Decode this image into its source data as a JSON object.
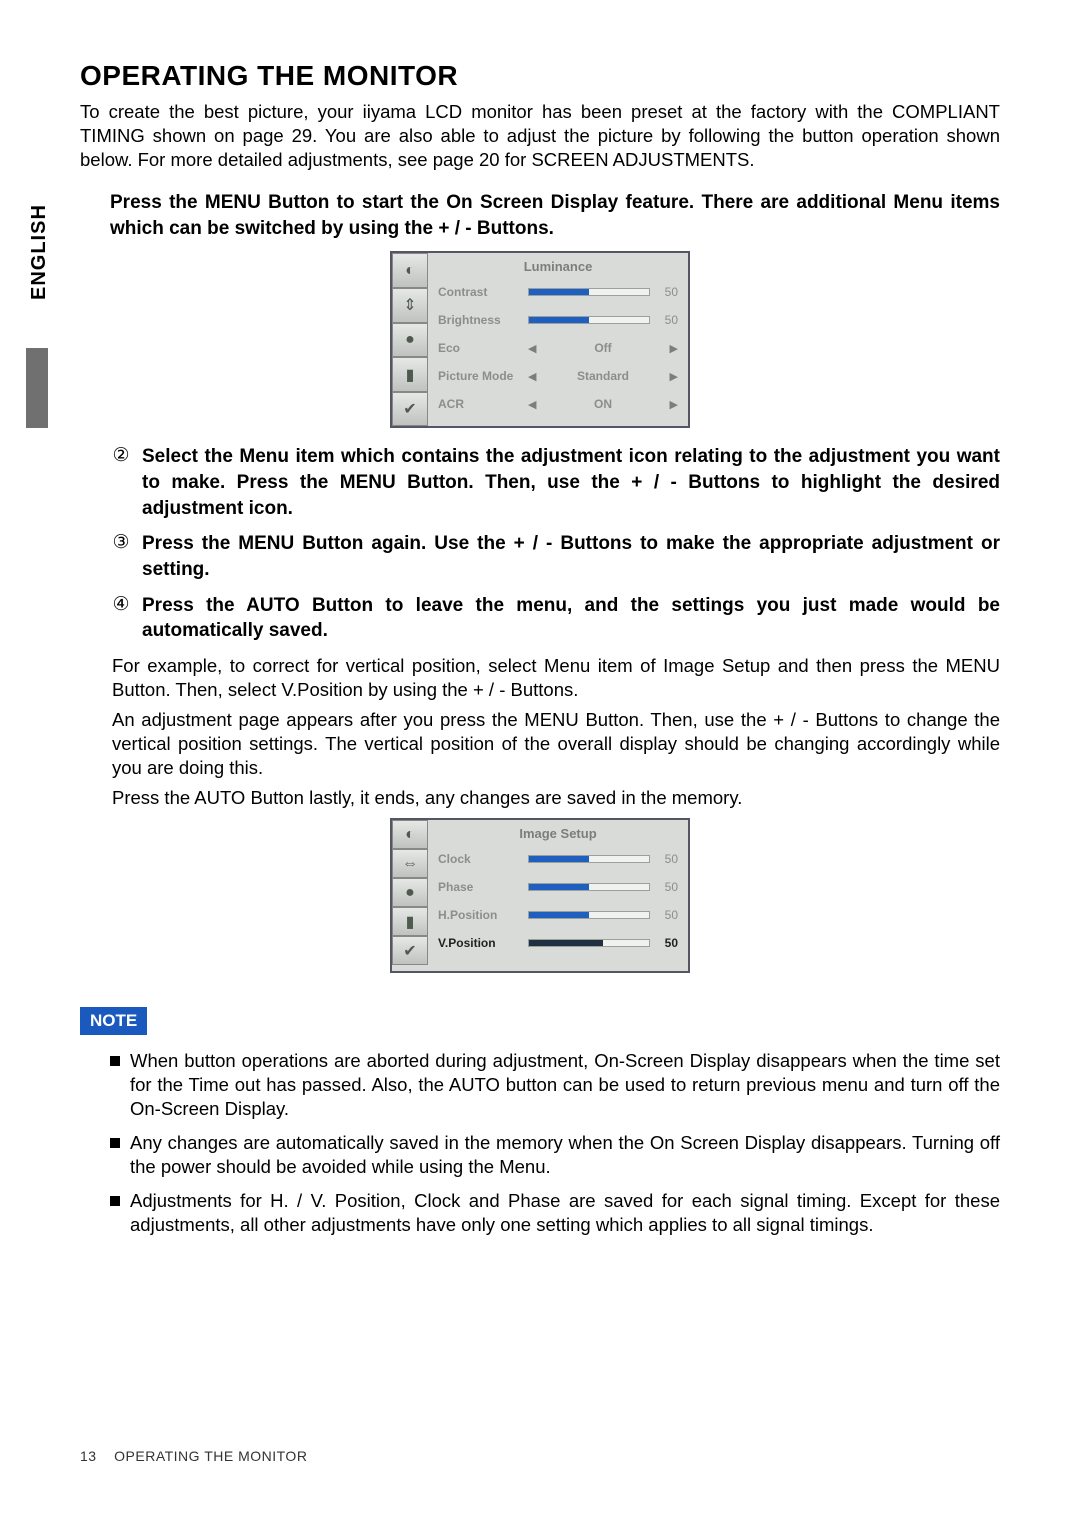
{
  "side_tab": "ENGLISH",
  "title": "OPERATING THE MONITOR",
  "intro": "To create the best picture, your iiyama LCD monitor has been preset at the factory with the COMPLIANT TIMING shown on page 29. You are also able to adjust the picture by following the button operation shown below. For more detailed adjustments, see page 20 for SCREEN ADJUSTMENTS.",
  "steps": {
    "s1": "Press the MENU Button to start the On Screen Display feature. There are additional Menu items which can be switched by using the + / - Buttons.",
    "s2_num": "②",
    "s2": "Select the Menu item which contains the adjustment icon relating to the adjustment you want to make. Press the MENU Button. Then, use the + / - Buttons to highlight the desired adjustment icon.",
    "s3_num": "③",
    "s3": "Press the MENU Button again. Use the + / - Buttons to make the appropriate adjustment or setting.",
    "s4_num": "④",
    "s4": "Press the AUTO Button to leave the menu, and the settings you just made would be automatically saved."
  },
  "example": {
    "p1": "For example, to correct for vertical position, select Menu item of Image Setup and then press the MENU Button. Then, select  V.Position by using the + / - Buttons.",
    "p2": "An adjustment page appears after you press the MENU Button. Then, use the + / - Buttons to change the vertical position settings. The vertical position of the overall display should be changing accordingly while you are doing this.",
    "p3": "Press the AUTO Button lastly, it ends, any changes are saved in the memory."
  },
  "note_label": "NOTE",
  "notes": {
    "n1": "When button operations are aborted during adjustment, On-Screen Display disappears when the time set for the Time out has passed. Also, the AUTO button can be used to return previous menu and turn off the On-Screen Display.",
    "n2": "Any changes are automatically saved in the memory when the On Screen Display disappears. Turning off the power should be avoided while using the Menu.",
    "n3": "Adjustments for H. / V. Position, Clock and Phase are saved for each signal timing. Except for these adjustments, all other adjustments have only one setting which applies to all signal timings."
  },
  "footer": {
    "page": "13",
    "label": "OPERATING THE MONITOR"
  },
  "osd1": {
    "title": "Luminance",
    "icons": [
      "◐",
      "⇕",
      "●",
      "▮",
      "✔"
    ],
    "rows": [
      {
        "label": "Contrast",
        "type": "slider",
        "value": "50",
        "fill": 50
      },
      {
        "label": "Brightness",
        "type": "slider",
        "value": "50",
        "fill": 50
      },
      {
        "label": "Eco",
        "type": "select",
        "value": "Off"
      },
      {
        "label": "Picture Mode",
        "type": "select",
        "value": "Standard"
      },
      {
        "label": "ACR",
        "type": "select",
        "value": "ON"
      }
    ]
  },
  "osd2": {
    "title": "Image Setup",
    "icons": [
      "◐",
      "⇔",
      "●",
      "▮",
      "✔"
    ],
    "rows": [
      {
        "label": "Clock",
        "type": "slider",
        "value": "50",
        "fill": 50,
        "active": false
      },
      {
        "label": "Phase",
        "type": "slider",
        "value": "50",
        "fill": 50,
        "active": false
      },
      {
        "label": "H.Position",
        "type": "slider",
        "value": "50",
        "fill": 50,
        "active": false
      },
      {
        "label": "V.Position",
        "type": "slider",
        "value": "50",
        "fill": 62,
        "active": true
      }
    ]
  }
}
